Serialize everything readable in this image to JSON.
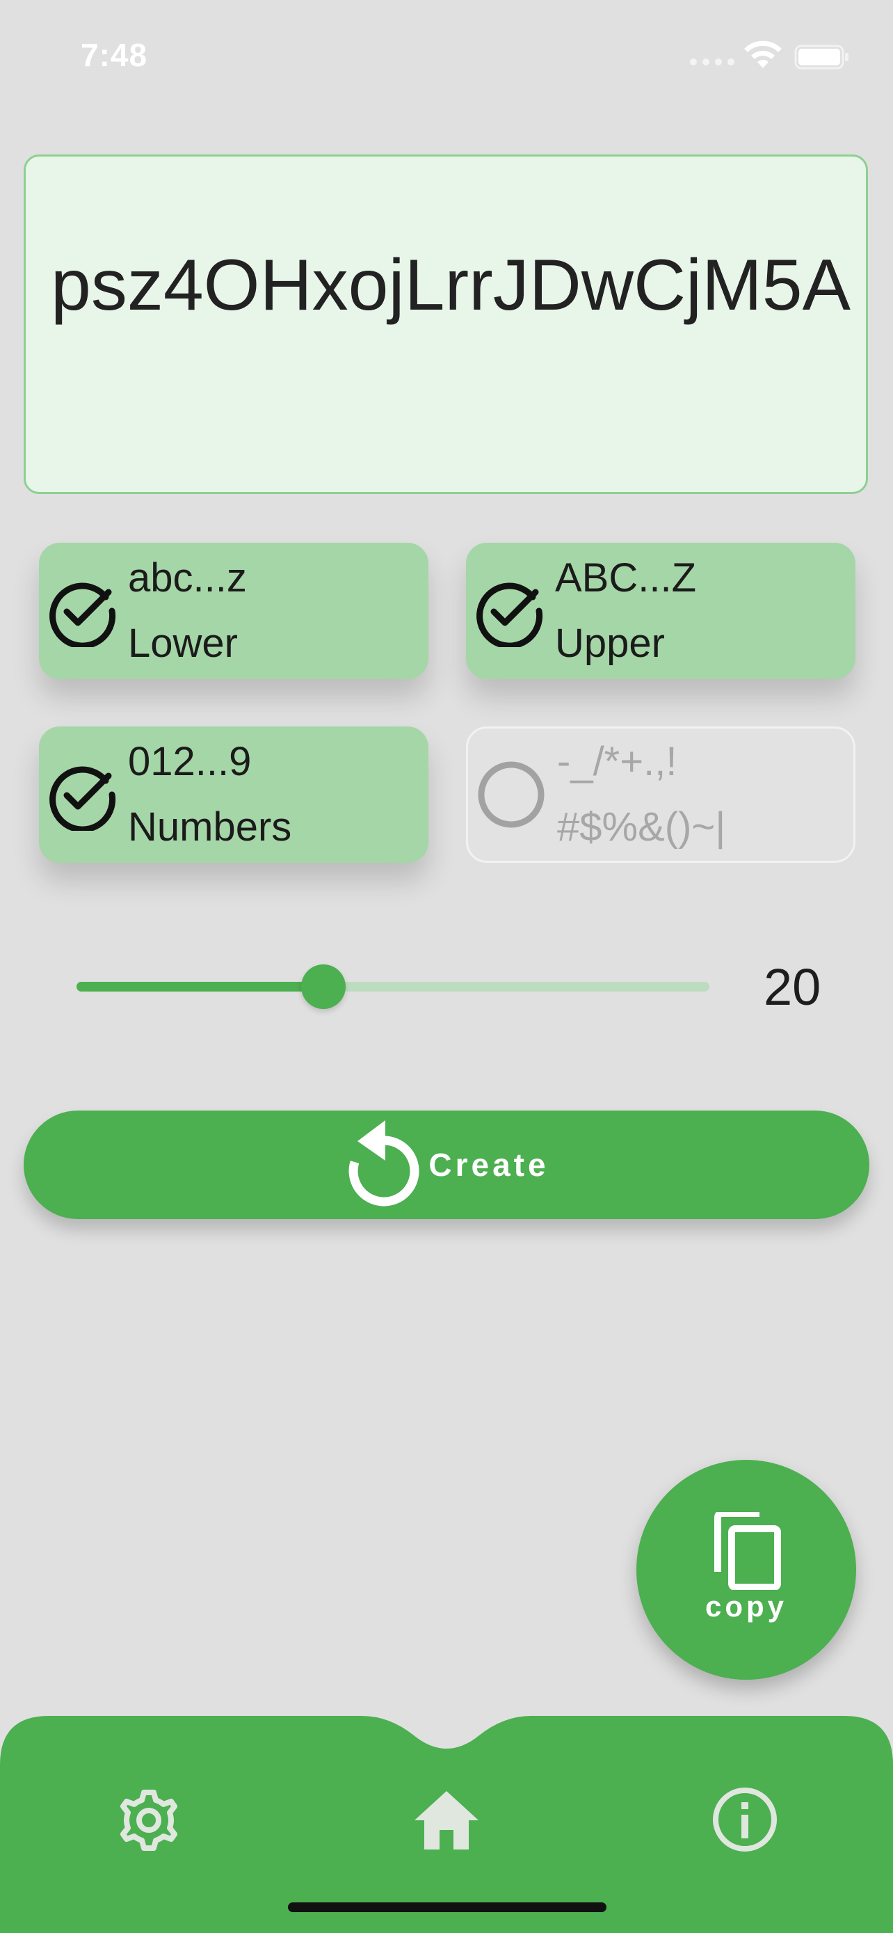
{
  "status_bar": {
    "time": "7:48"
  },
  "password": {
    "value": "psz4OHxojLrrJDwCjM5A"
  },
  "options": [
    {
      "id": "lower",
      "line1": "abc...z",
      "line2": "Lower",
      "checked": true
    },
    {
      "id": "upper",
      "line1": "ABC...Z",
      "line2": "Upper",
      "checked": true
    },
    {
      "id": "numbers",
      "line1": "012...9",
      "line2": "Numbers",
      "checked": true
    },
    {
      "id": "special",
      "line1": "-_/*+.,!",
      "line2": "#$%&()~|",
      "checked": false
    }
  ],
  "length": {
    "value": "20",
    "fraction": 0.39
  },
  "create_button": {
    "label": "Create"
  },
  "copy_button": {
    "label": "copy"
  },
  "bottom_nav": {
    "icons": [
      "settings-icon",
      "home-icon",
      "info-icon"
    ]
  },
  "colors": {
    "accent": "#4caf50",
    "chip_on": "#a5d6a7",
    "password_bg": "#e8f5e9",
    "background": "#e0e0e0"
  }
}
